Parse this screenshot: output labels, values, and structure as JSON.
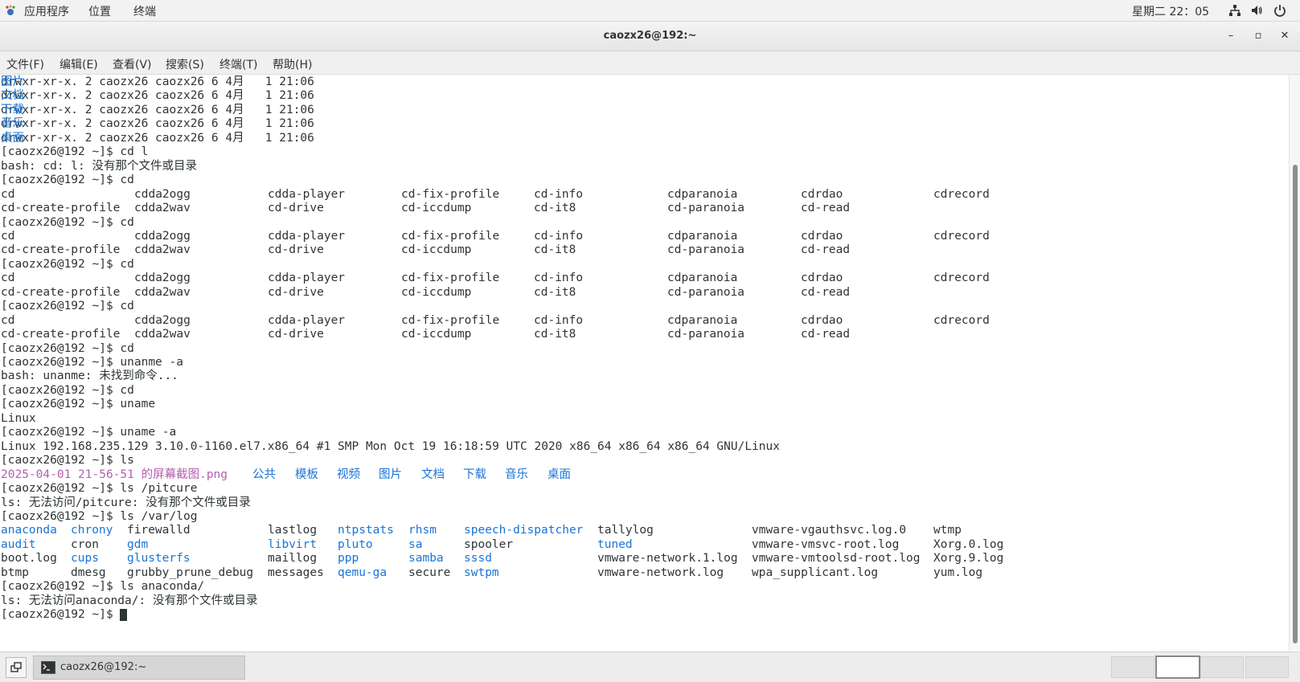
{
  "topbar": {
    "applications": "应用程序",
    "places": "位置",
    "terminal": "终端",
    "clock": "星期二 22：05"
  },
  "window": {
    "title": "caozx26@192:~",
    "minimize": "–",
    "maximize": "▫",
    "close": "✕"
  },
  "menu": [
    "文件(F)",
    "编辑(E)",
    "查看(V)",
    "搜索(S)",
    "终端(T)",
    "帮助(H)"
  ],
  "colors": {
    "link_blue": "#1a73d6",
    "image_purple": "#b460b0",
    "text": "#2e3436"
  },
  "terminal": {
    "lines": [
      [
        {
          "t": "drwxr-xr-x. 2 caozx26 caozx26 6 4月   1 21:06 "
        },
        {
          "t": "图片",
          "c": "blue"
        }
      ],
      [
        {
          "t": "drwxr-xr-x. 2 caozx26 caozx26 6 4月   1 21:06 "
        },
        {
          "t": "文档",
          "c": "blue"
        }
      ],
      [
        {
          "t": "drwxr-xr-x. 2 caozx26 caozx26 6 4月   1 21:06 "
        },
        {
          "t": "下载",
          "c": "blue"
        }
      ],
      [
        {
          "t": "drwxr-xr-x. 2 caozx26 caozx26 6 4月   1 21:06 "
        },
        {
          "t": "音乐",
          "c": "blue"
        }
      ],
      [
        {
          "t": "drwxr-xr-x. 2 caozx26 caozx26 6 4月   1 21:06 "
        },
        {
          "t": "桌面",
          "c": "blue"
        }
      ],
      [
        {
          "t": "[caozx26@192 ~]$ cd l"
        }
      ],
      [
        {
          "t": "bash: cd: l: 没有那个文件或目录"
        }
      ],
      [
        {
          "t": "[caozx26@192 ~]$ cd"
        }
      ],
      [
        {
          "t": "cd",
          "col": 0
        },
        {
          "t": "cdda2ogg",
          "col": 1
        },
        {
          "t": "cdda-player",
          "col": 2
        },
        {
          "t": "cd-fix-profile",
          "col": 3
        },
        {
          "t": "cd-info",
          "col": 4
        },
        {
          "t": "cdparanoia",
          "col": 5
        },
        {
          "t": "cdrdao",
          "col": 6
        },
        {
          "t": "cdrecord",
          "col": 7
        }
      ],
      [
        {
          "t": "cd-create-profile",
          "col": 0
        },
        {
          "t": "cdda2wav",
          "col": 1
        },
        {
          "t": "cd-drive",
          "col": 2
        },
        {
          "t": "cd-iccdump",
          "col": 3
        },
        {
          "t": "cd-it8",
          "col": 4
        },
        {
          "t": "cd-paranoia",
          "col": 5
        },
        {
          "t": "cd-read",
          "col": 6
        }
      ],
      [
        {
          "t": "[caozx26@192 ~]$ cd"
        }
      ],
      [
        {
          "t": "cd",
          "col": 0
        },
        {
          "t": "cdda2ogg",
          "col": 1
        },
        {
          "t": "cdda-player",
          "col": 2
        },
        {
          "t": "cd-fix-profile",
          "col": 3
        },
        {
          "t": "cd-info",
          "col": 4
        },
        {
          "t": "cdparanoia",
          "col": 5
        },
        {
          "t": "cdrdao",
          "col": 6
        },
        {
          "t": "cdrecord",
          "col": 7
        }
      ],
      [
        {
          "t": "cd-create-profile",
          "col": 0
        },
        {
          "t": "cdda2wav",
          "col": 1
        },
        {
          "t": "cd-drive",
          "col": 2
        },
        {
          "t": "cd-iccdump",
          "col": 3
        },
        {
          "t": "cd-it8",
          "col": 4
        },
        {
          "t": "cd-paranoia",
          "col": 5
        },
        {
          "t": "cd-read",
          "col": 6
        }
      ],
      [
        {
          "t": "[caozx26@192 ~]$ cd"
        }
      ],
      [
        {
          "t": "cd",
          "col": 0
        },
        {
          "t": "cdda2ogg",
          "col": 1
        },
        {
          "t": "cdda-player",
          "col": 2
        },
        {
          "t": "cd-fix-profile",
          "col": 3
        },
        {
          "t": "cd-info",
          "col": 4
        },
        {
          "t": "cdparanoia",
          "col": 5
        },
        {
          "t": "cdrdao",
          "col": 6
        },
        {
          "t": "cdrecord",
          "col": 7
        }
      ],
      [
        {
          "t": "cd-create-profile",
          "col": 0
        },
        {
          "t": "cdda2wav",
          "col": 1
        },
        {
          "t": "cd-drive",
          "col": 2
        },
        {
          "t": "cd-iccdump",
          "col": 3
        },
        {
          "t": "cd-it8",
          "col": 4
        },
        {
          "t": "cd-paranoia",
          "col": 5
        },
        {
          "t": "cd-read",
          "col": 6
        }
      ],
      [
        {
          "t": "[caozx26@192 ~]$ cd"
        }
      ],
      [
        {
          "t": "cd",
          "col": 0
        },
        {
          "t": "cdda2ogg",
          "col": 1
        },
        {
          "t": "cdda-player",
          "col": 2
        },
        {
          "t": "cd-fix-profile",
          "col": 3
        },
        {
          "t": "cd-info",
          "col": 4
        },
        {
          "t": "cdparanoia",
          "col": 5
        },
        {
          "t": "cdrdao",
          "col": 6
        },
        {
          "t": "cdrecord",
          "col": 7
        }
      ],
      [
        {
          "t": "cd-create-profile",
          "col": 0
        },
        {
          "t": "cdda2wav",
          "col": 1
        },
        {
          "t": "cd-drive",
          "col": 2
        },
        {
          "t": "cd-iccdump",
          "col": 3
        },
        {
          "t": "cd-it8",
          "col": 4
        },
        {
          "t": "cd-paranoia",
          "col": 5
        },
        {
          "t": "cd-read",
          "col": 6
        }
      ],
      [
        {
          "t": "[caozx26@192 ~]$ cd"
        }
      ],
      [
        {
          "t": "[caozx26@192 ~]$ unanme -a"
        }
      ],
      [
        {
          "t": "bash: unanme: 未找到命令..."
        }
      ],
      [
        {
          "t": "[caozx26@192 ~]$ cd"
        }
      ],
      [
        {
          "t": "[caozx26@192 ~]$ uname"
        }
      ],
      [
        {
          "t": "Linux"
        }
      ],
      [
        {
          "t": "[caozx26@192 ~]$ uname -a"
        }
      ],
      [
        {
          "t": "Linux 192.168.235.129 3.10.0-1160.el7.x86_64 #1 SMP Mon Oct 19 16:18:59 UTC 2020 x86_64 x86_64 x86_64 GNU/Linux"
        }
      ],
      [
        {
          "t": "[caozx26@192 ~]$ ls"
        }
      ],
      [
        {
          "t": "2025-04-01 21-56-51 的屏幕截图.png",
          "c": "purple"
        },
        {
          "t": "公共",
          "c": "blue",
          "col": "p1"
        },
        {
          "t": "模板",
          "c": "blue",
          "col": "p2"
        },
        {
          "t": "视频",
          "c": "blue",
          "col": "p3"
        },
        {
          "t": "图片",
          "c": "blue",
          "col": "p4"
        },
        {
          "t": "文档",
          "c": "blue",
          "col": "p5"
        },
        {
          "t": "下载",
          "c": "blue",
          "col": "p6"
        },
        {
          "t": "音乐",
          "c": "blue",
          "col": "p7"
        },
        {
          "t": "桌面",
          "c": "blue",
          "col": "p8"
        }
      ],
      [
        {
          "t": "[caozx26@192 ~]$ ls /pitcure"
        }
      ],
      [
        {
          "t": "ls: 无法访问/pitcure: 没有那个文件或目录"
        }
      ],
      [
        {
          "t": "[caozx26@192 ~]$ ls /var/log"
        }
      ],
      [
        {
          "t": "anaconda",
          "c": "blue",
          "col": "l0"
        },
        {
          "t": "chrony",
          "c": "blue",
          "col": "l1"
        },
        {
          "t": "firewalld",
          "col": "l2"
        },
        {
          "t": "lastlog",
          "col": "l3"
        },
        {
          "t": "ntpstats",
          "c": "blue",
          "col": "l4"
        },
        {
          "t": "rhsm",
          "c": "blue",
          "col": "l5"
        },
        {
          "t": "speech-dispatcher",
          "c": "blue",
          "col": "l6"
        },
        {
          "t": "tallylog",
          "col": "l7"
        },
        {
          "t": "vmware-vgauthsvc.log.0",
          "col": "l8"
        },
        {
          "t": "wtmp",
          "col": "l9"
        }
      ],
      [
        {
          "t": "audit",
          "c": "blue",
          "col": "l0"
        },
        {
          "t": "cron",
          "col": "l1"
        },
        {
          "t": "gdm",
          "c": "blue",
          "col": "l2"
        },
        {
          "t": "libvirt",
          "c": "blue",
          "col": "l3"
        },
        {
          "t": "pluto",
          "c": "blue",
          "col": "l4"
        },
        {
          "t": "sa",
          "c": "blue",
          "col": "l5"
        },
        {
          "t": "spooler",
          "col": "l6"
        },
        {
          "t": "tuned",
          "c": "blue",
          "col": "l7"
        },
        {
          "t": "vmware-vmsvc-root.log",
          "col": "l8"
        },
        {
          "t": "Xorg.0.log",
          "col": "l9"
        }
      ],
      [
        {
          "t": "boot.log",
          "col": "l0"
        },
        {
          "t": "cups",
          "c": "blue",
          "col": "l1"
        },
        {
          "t": "glusterfs",
          "c": "blue",
          "col": "l2"
        },
        {
          "t": "maillog",
          "col": "l3"
        },
        {
          "t": "ppp",
          "c": "blue",
          "col": "l4"
        },
        {
          "t": "samba",
          "c": "blue",
          "col": "l5"
        },
        {
          "t": "sssd",
          "c": "blue",
          "col": "l6"
        },
        {
          "t": "vmware-network.1.log",
          "col": "l7"
        },
        {
          "t": "vmware-vmtoolsd-root.log",
          "col": "l8"
        },
        {
          "t": "Xorg.9.log",
          "col": "l9"
        }
      ],
      [
        {
          "t": "btmp",
          "col": "l0"
        },
        {
          "t": "dmesg",
          "col": "l1"
        },
        {
          "t": "grubby_prune_debug",
          "col": "l2"
        },
        {
          "t": "messages",
          "col": "l3"
        },
        {
          "t": "qemu-ga",
          "c": "blue",
          "col": "l4"
        },
        {
          "t": "secure",
          "col": "l5"
        },
        {
          "t": "swtpm",
          "c": "blue",
          "col": "l6"
        },
        {
          "t": "vmware-network.log",
          "col": "l7"
        },
        {
          "t": "wpa_supplicant.log",
          "col": "l8"
        },
        {
          "t": "yum.log",
          "col": "l9"
        }
      ],
      [
        {
          "t": "[caozx26@192 ~]$ ls anaconda/"
        }
      ],
      [
        {
          "t": "ls: 无法访问anaconda/: 没有那个文件或目录"
        }
      ],
      [
        {
          "t": "[caozx26@192 ~]$ "
        }
      ]
    ]
  },
  "taskbar": {
    "task_label": "caozx26@192:~",
    "workspaces": [
      "",
      "",
      "",
      ""
    ]
  }
}
